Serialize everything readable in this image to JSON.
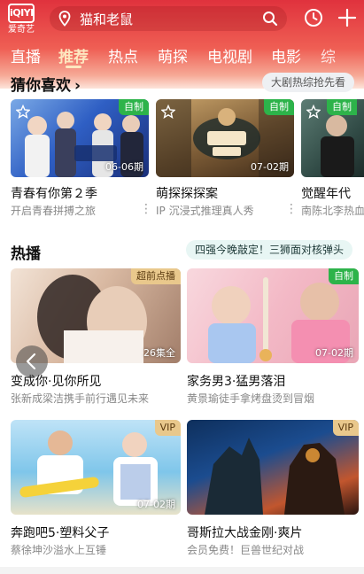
{
  "app": {
    "logo_mark": "iQIYI",
    "logo_text": "爱奇艺"
  },
  "search": {
    "placeholder_value": "猫和老鼠"
  },
  "tabs": [
    {
      "label": "直播"
    },
    {
      "label": "推荐"
    },
    {
      "label": "热点"
    },
    {
      "label": "萌探"
    },
    {
      "label": "电视剧"
    },
    {
      "label": "电影"
    },
    {
      "label": "综"
    }
  ],
  "active_tab": "推荐",
  "colors": {
    "brand_red": "#e0323d",
    "vip_gold": "#e9c88c",
    "self_made_green": "#2db34a",
    "pill_bg": "#eef6f6"
  },
  "guess": {
    "title": "猜你喜欢",
    "arrow": "›",
    "pill": "大剧热综抢先看",
    "cards": [
      {
        "badge": "自制",
        "episode": "06-06期",
        "title": "青春有你第２季",
        "subtitle": "开启青春拼搏之旅"
      },
      {
        "badge": "自制",
        "episode": "07-02期",
        "title": "萌探探探案",
        "subtitle": "IP 沉浸式推理真人秀"
      },
      {
        "badge": "自制",
        "episode": "",
        "title": "觉醒年代",
        "subtitle": "南陈北李热血"
      }
    ]
  },
  "hot": {
    "title": "热播",
    "pill": "四强今晚敲定！三狮面对核弹头",
    "cards": [
      {
        "badge": "超前点播",
        "episode": "26集全",
        "title": "变成你·见你所见",
        "subtitle": "张新成梁洁携手前行遇见未来"
      },
      {
        "badge": "自制",
        "episode": "07-02期",
        "title": "家务男3·猛男落泪",
        "subtitle": "黄景瑜徒手拿烤盘烫到冒烟"
      },
      {
        "badge": "VIP",
        "episode": "07-02期",
        "title": "奔跑吧5·塑料父子",
        "subtitle": "蔡徐坤沙溢水上互锤"
      },
      {
        "badge": "VIP",
        "episode": "",
        "title": "哥斯拉大战金刚·爽片",
        "subtitle": "会员免费！巨兽世纪对战"
      }
    ]
  },
  "icons": {
    "search_pin": "location-pin-icon",
    "search_mag": "magnifier-icon",
    "history": "clock-icon",
    "add": "plus-icon",
    "favorite": "star-icon",
    "more": "vertical-dots-icon",
    "back": "chevron-left-icon"
  }
}
